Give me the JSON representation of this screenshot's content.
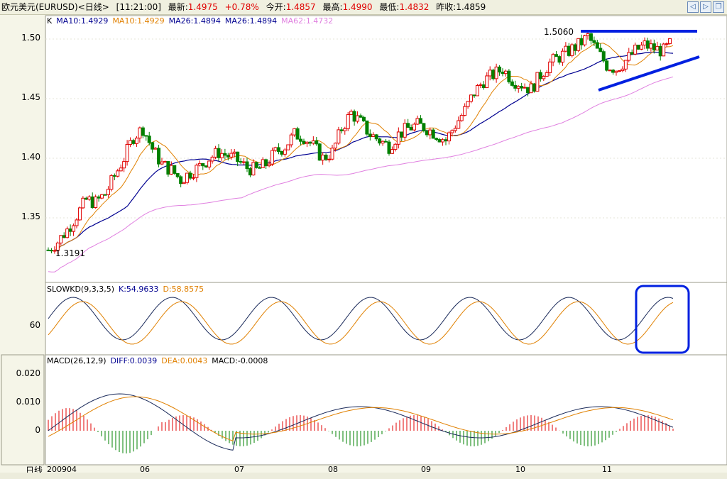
{
  "header": {
    "instrument": "欧元美元(EURUSD)<日线>",
    "time": "[11:21:00]",
    "latest_label": "最新:",
    "latest_value": "1.4975",
    "change": "+0.78%",
    "open_label": "今开:",
    "open_value": "1.4857",
    "high_label": "最高:",
    "high_value": "1.4990",
    "low_label": "最低:",
    "low_value": "1.4832",
    "prev_label": "昨收:",
    "prev_value": "1.4859"
  },
  "nav": {
    "back_icon": "◁",
    "forward_icon": "▷",
    "window_icon": "❐"
  },
  "main_legend": {
    "k": "K",
    "ma10a": "MA10:1.4929",
    "ma10b": "MA10:1.4929",
    "ma26a": "MA26:1.4894",
    "ma26b": "MA26:1.4894",
    "ma62": "MA62:1.4732"
  },
  "kd_legend": {
    "name": "SLOWKD(9,3,3,5)",
    "k": "K:54.9633",
    "d": "D:58.8575"
  },
  "macd_legend": {
    "name": "MACD(26,12,9)",
    "diff": "DIFF:0.0039",
    "dea": "DEA:0.0043",
    "macd": "MACD:-0.0008"
  },
  "annotations": {
    "high": "1.5060",
    "low": "1.3191"
  },
  "x_axis": {
    "period_label": "日线",
    "ticks": [
      "200904",
      "06",
      "07",
      "08",
      "09",
      "10",
      "11"
    ]
  },
  "colors": {
    "up": "#e00000",
    "down": "#008000",
    "ma10": "#e08000",
    "ma26": "#000090",
    "ma62": "#e080e0",
    "kd_k": "#1a2a5a",
    "kd_d": "#e08000",
    "trend": "#0020e0"
  },
  "chart_data": [
    {
      "type": "candlestick",
      "title": "EURUSD 日线",
      "y_ticks": [
        "1.50",
        "1.45",
        "1.40",
        "1.35"
      ],
      "ylim": [
        1.3,
        1.51
      ],
      "key_levels": {
        "high": 1.506,
        "low": 1.3191
      },
      "ma_latest": {
        "MA10": 1.4929,
        "MA26": 1.4894,
        "MA62": 1.4732
      },
      "last_bar": {
        "open": 1.4857,
        "high": 1.499,
        "low": 1.4832,
        "close": 1.4975,
        "prev_close": 1.4859
      },
      "close_path": [
        1.323,
        1.33,
        1.34,
        1.352,
        1.365,
        1.363,
        1.37,
        1.385,
        1.4,
        1.418,
        1.425,
        1.408,
        1.395,
        1.39,
        1.382,
        1.388,
        1.393,
        1.4,
        1.405,
        1.402,
        1.398,
        1.392,
        1.39,
        1.395,
        1.405,
        1.41,
        1.42,
        1.418,
        1.41,
        1.4,
        1.405,
        1.425,
        1.438,
        1.43,
        1.42,
        1.415,
        1.41,
        1.42,
        1.425,
        1.428,
        1.425,
        1.42,
        1.415,
        1.428,
        1.44,
        1.455,
        1.465,
        1.47,
        1.475,
        1.466,
        1.462,
        1.458,
        1.47,
        1.48,
        1.485,
        1.49,
        1.495,
        1.502,
        1.49,
        1.478,
        1.475,
        1.482,
        1.49,
        1.495,
        1.492,
        1.49,
        1.498
      ]
    },
    {
      "type": "line",
      "title": "SLOWKD(9,3,3,5)",
      "y_ticks": [
        "60"
      ],
      "series": [
        {
          "name": "K",
          "latest": 54.9633
        },
        {
          "name": "D",
          "latest": 58.8575
        }
      ]
    },
    {
      "type": "bar",
      "title": "MACD(26,12,9)",
      "y_ticks": [
        "0.020",
        "0.010",
        "0"
      ],
      "series": [
        {
          "name": "DIFF",
          "latest": 0.0039
        },
        {
          "name": "DEA",
          "latest": 0.0043
        },
        {
          "name": "MACD",
          "latest": -0.0008
        }
      ]
    }
  ]
}
